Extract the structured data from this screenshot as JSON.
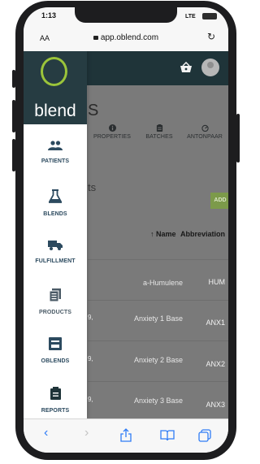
{
  "status_bar": {
    "time": "1:13",
    "signal": "LTE"
  },
  "browser": {
    "text_size_label": "AA",
    "url": "app.oblend.com"
  },
  "app": {
    "brand": "blend",
    "page_title": "S",
    "section_title": "ts",
    "add_button": "ADD",
    "tabs": [
      {
        "label": "PROPERTIES",
        "icon": "info-icon"
      },
      {
        "label": "BATCHES",
        "icon": "clipboard-icon"
      },
      {
        "label": "ANTONPAAR",
        "icon": "gauge-icon"
      }
    ],
    "table": {
      "headers": {
        "name": "↑ Name",
        "abbreviation": "Abbreviation"
      },
      "rows": [
        {
          "date": "",
          "name": "a-Humulene",
          "abbreviation": "HUM"
        },
        {
          "date": "9,",
          "name": "Anxiety 1 Base",
          "abbreviation": "ANX1"
        },
        {
          "date": "9,",
          "name": "Anxiety 2 Base",
          "abbreviation": "ANX2"
        },
        {
          "date": "9,",
          "name": "Anxiety 3 Base",
          "abbreviation": "ANX3"
        }
      ]
    }
  },
  "sidebar": {
    "items": [
      {
        "label": "PATIENTS",
        "icon": "patients-icon"
      },
      {
        "label": "BLENDS",
        "icon": "flask-icon"
      },
      {
        "label": "FULFILLMENT",
        "icon": "truck-icon"
      },
      {
        "label": "PRODUCTS",
        "icon": "products-icon"
      },
      {
        "label": "OBLENDS",
        "icon": "oblends-icon"
      },
      {
        "label": "REPORTS",
        "icon": "reports-icon"
      }
    ]
  },
  "colors": {
    "topbar": "#1f3439",
    "logo_green": "#9bc43a",
    "nav_text": "#2c4a5f",
    "add_button": "#7c9a4a",
    "ios_blue": "#2f7cf6"
  }
}
